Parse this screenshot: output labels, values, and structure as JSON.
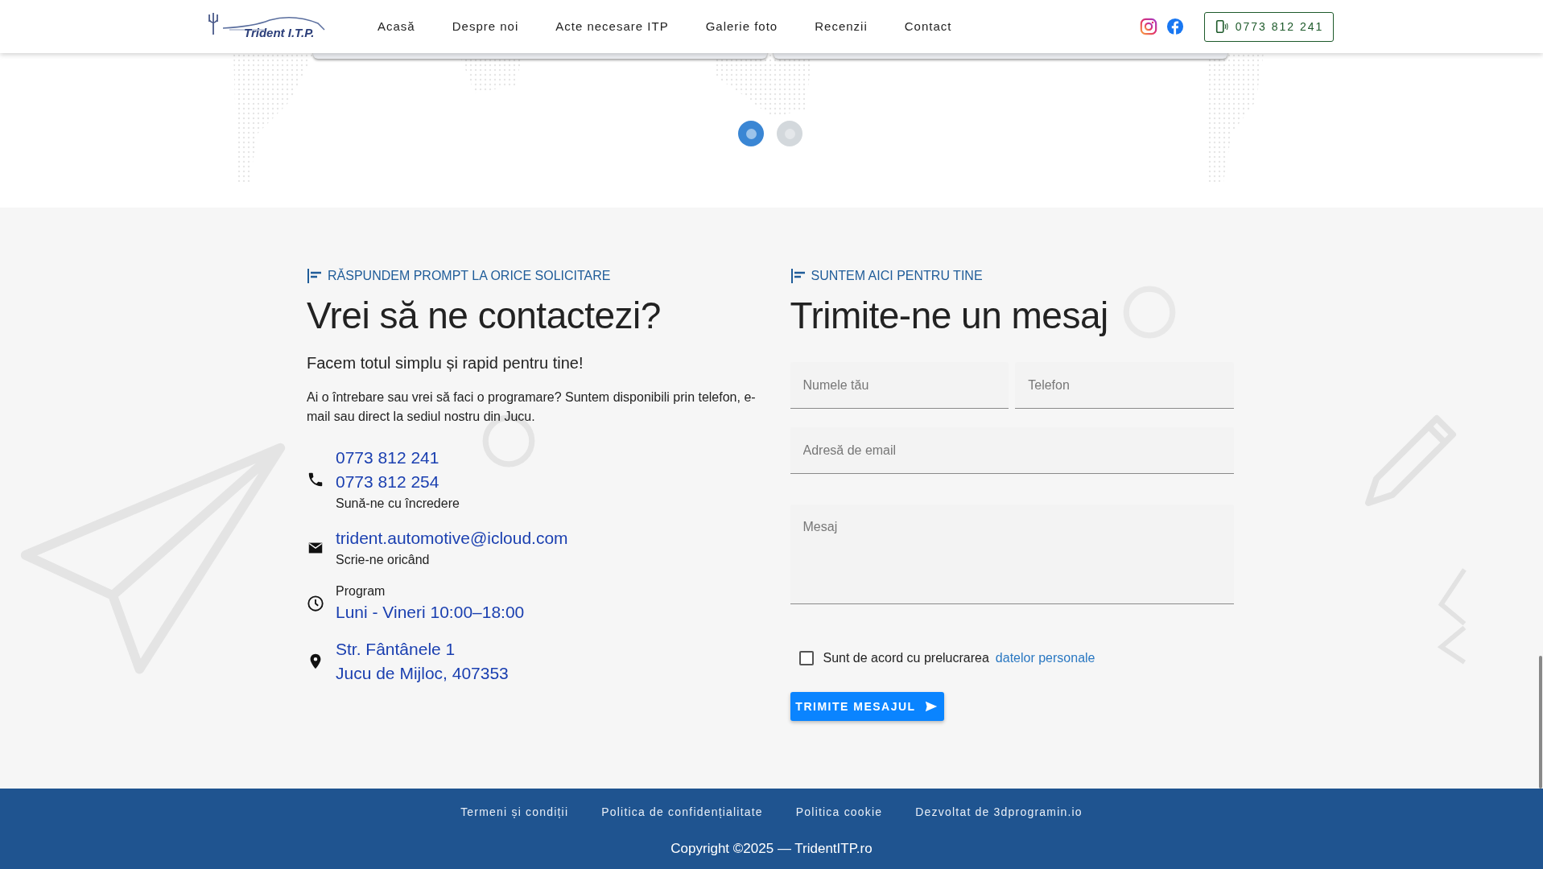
{
  "header": {
    "logo_text": "Trident I.T.P.",
    "nav": [
      {
        "label": "Acasă"
      },
      {
        "label": "Despre noi"
      },
      {
        "label": "Acte necesare ITP"
      },
      {
        "label": "Galerie foto"
      },
      {
        "label": "Recenzii"
      },
      {
        "label": "Contact"
      }
    ],
    "phone_button": "0773 812 241"
  },
  "slider": {
    "dots": [
      {
        "selected": true
      },
      {
        "selected": false
      }
    ]
  },
  "contact": {
    "tagline": "RĂSPUNDEM PROMPT LA ORICE SOLICITARE",
    "heading": "Vrei să ne contactezi?",
    "subheading": "Facem totul simplu și rapid pentru tine!",
    "paragraph": "Ai o întrebare sau vrei să faci o programare? Suntem disponibili prin telefon, e-mail sau direct la sediul nostru din Jucu.",
    "items": [
      {
        "kind": "phone",
        "links": [
          "0773 812 241",
          "0773 812 254"
        ],
        "note": "Sună-ne cu încredere"
      },
      {
        "kind": "email",
        "links": [
          "trident.automotive@icloud.com"
        ],
        "note": "Scrie-ne oricând"
      },
      {
        "kind": "clock",
        "label": "Program",
        "links": [
          "Luni - Vineri 10:00–18:00"
        ]
      },
      {
        "kind": "pin",
        "links": [
          "Str. Fântânele 1",
          "Jucu de Mijloc, 407353"
        ]
      }
    ]
  },
  "form": {
    "tagline": "SUNTEM AICI PENTRU TINE",
    "heading": "Trimite-ne un mesaj",
    "fields": [
      {
        "kind": "half",
        "placeholder": "Numele tău"
      },
      {
        "kind": "half",
        "placeholder": "Telefon"
      },
      {
        "kind": "full",
        "placeholder": "Adresă de email"
      },
      {
        "kind": "textarea",
        "placeholder": "Mesaj"
      }
    ],
    "consent": {
      "checked": false,
      "text": "Sunt de acord cu prelucrarea",
      "link": "datelor personale"
    },
    "submit": "TRIMITE MESAJUL"
  },
  "footer": {
    "links": [
      "Termeni și condiții",
      "Politica de confidențialitate",
      "Politica cookie",
      "Dezvoltat de 3dprogramin.io"
    ],
    "copyright": "Copyright ©2025 — TridentITP.ro"
  }
}
